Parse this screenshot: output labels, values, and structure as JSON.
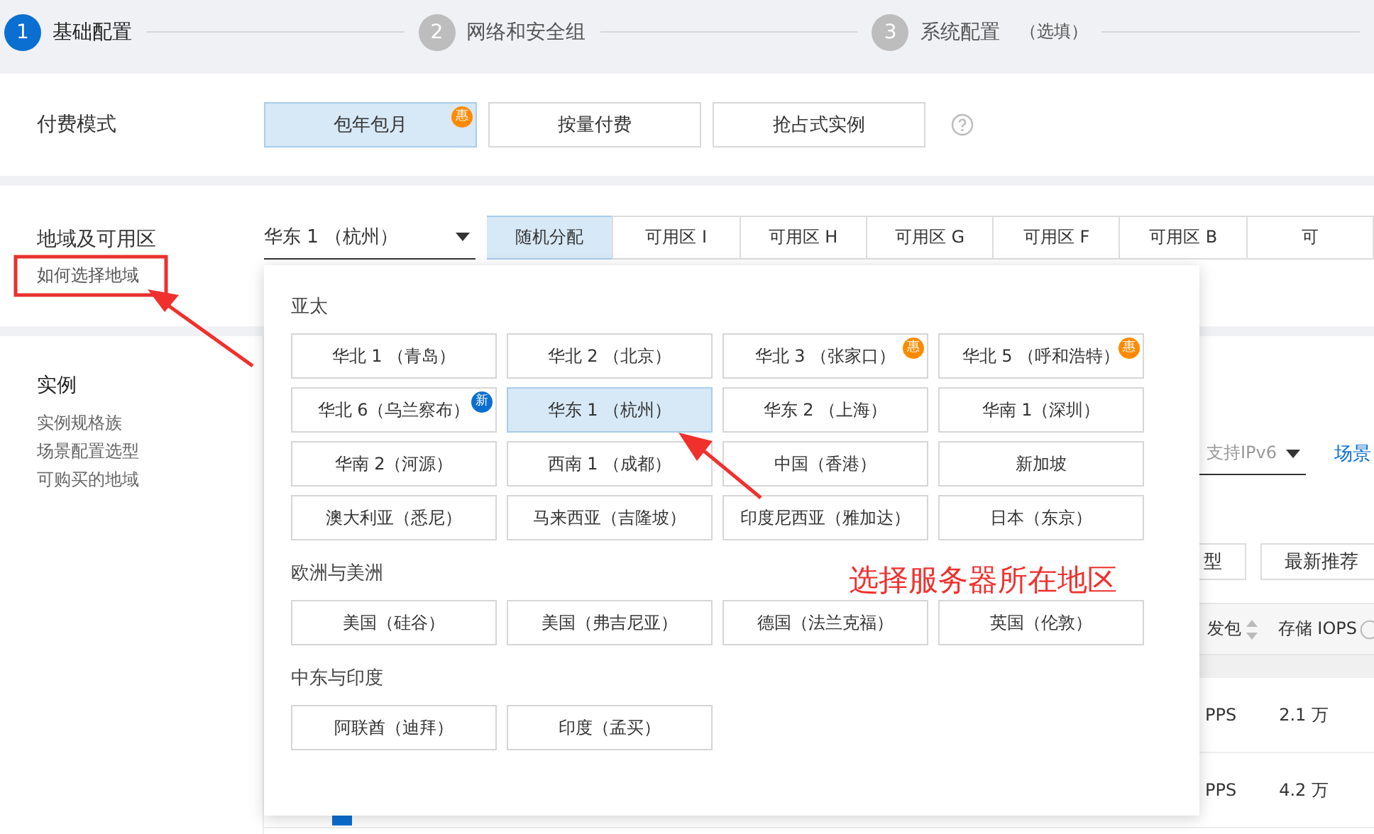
{
  "steps": [
    {
      "number": "1",
      "label": "基础配置",
      "selected": true
    },
    {
      "number": "2",
      "label": "网络和安全组",
      "selected": false
    },
    {
      "number": "3",
      "label": "系统配置",
      "note": "（选填）",
      "selected": false
    }
  ],
  "billing": {
    "label": "付费模式",
    "options": [
      {
        "label": "包年包月",
        "selected": true,
        "badge": {
          "text": "惠",
          "color": "#ff8a00"
        }
      },
      {
        "label": "按量付费",
        "selected": false
      },
      {
        "label": "抢占式实例",
        "selected": false
      }
    ]
  },
  "region": {
    "label": "地域及可用区",
    "help_link": "如何选择地域",
    "dropdown": {
      "value": "华东 1 （杭州）"
    },
    "zones": [
      {
        "label": "随机分配",
        "selected": true
      },
      {
        "label": "可用区 I",
        "selected": false
      },
      {
        "label": "可用区 H",
        "selected": false
      },
      {
        "label": "可用区 G",
        "selected": false
      },
      {
        "label": "可用区 F",
        "selected": false
      },
      {
        "label": "可用区 B",
        "selected": false
      },
      {
        "label": "可",
        "selected": false
      }
    ]
  },
  "instance": {
    "title": "实例",
    "links": [
      "实例规格族",
      "场景配置选型",
      "可购买的地域"
    ]
  },
  "background_table": {
    "filter": {
      "value": "支持IPv6"
    },
    "scene_link": "场景",
    "buttons": [
      "型",
      "最新推荐"
    ],
    "columns": [
      "发包",
      "存储 IOPS"
    ],
    "rows": [
      [
        "PPS",
        "2.1 万"
      ],
      [
        "PPS",
        "4.2 万"
      ]
    ]
  },
  "region_dropdown": {
    "groups": [
      {
        "title": "亚太",
        "regions": [
          {
            "label": "华北 1 （青岛）",
            "selected": false
          },
          {
            "label": "华北 2 （北京）",
            "selected": false
          },
          {
            "label": "华北 3 （张家口）",
            "selected": false,
            "badge": {
              "text": "惠",
              "color": "#ff8a00"
            }
          },
          {
            "label": "华北 5 （呼和浩特）",
            "selected": false,
            "badge": {
              "text": "惠",
              "color": "#ff8a00"
            }
          },
          {
            "label": "华北 6（乌兰察布）",
            "selected": false,
            "badge": {
              "text": "新",
              "color": "#0a6fd1"
            }
          },
          {
            "label": "华东 1 （杭州）",
            "selected": true
          },
          {
            "label": "华东 2 （上海）",
            "selected": false
          },
          {
            "label": "华南 1（深圳）",
            "selected": false
          },
          {
            "label": "华南 2（河源）",
            "selected": false
          },
          {
            "label": "西南 1 （成都）",
            "selected": false
          },
          {
            "label": "中国（香港）",
            "selected": false
          },
          {
            "label": "新加坡",
            "selected": false
          },
          {
            "label": "澳大利亚（悉尼）",
            "selected": false
          },
          {
            "label": "马来西亚（吉隆坡）",
            "selected": false
          },
          {
            "label": "印度尼西亚（雅加达）",
            "selected": false
          },
          {
            "label": "日本（东京）",
            "selected": false
          }
        ]
      },
      {
        "title": "欧洲与美洲",
        "regions": [
          {
            "label": "美国（硅谷）",
            "selected": false
          },
          {
            "label": "美国（弗吉尼亚）",
            "selected": false
          },
          {
            "label": "德国（法兰克福）",
            "selected": false
          },
          {
            "label": "英国（伦敦）",
            "selected": false
          }
        ]
      },
      {
        "title": "中东与印度",
        "regions": [
          {
            "label": "阿联酋（迪拜）",
            "selected": false
          },
          {
            "label": "印度（孟买）",
            "selected": false
          }
        ]
      }
    ]
  },
  "annotation": {
    "caption": "选择服务器所在地区"
  }
}
